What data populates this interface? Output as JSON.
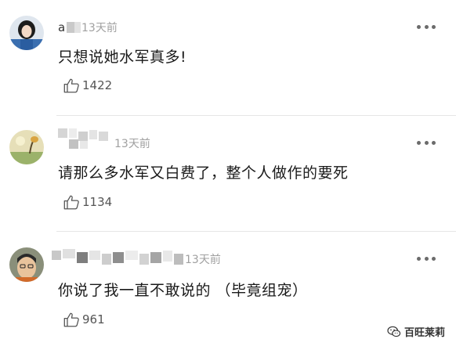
{
  "comments": [
    {
      "time": "13天前",
      "text": "只想说她水军真多!",
      "likes": "1422",
      "avatar_icon": "avatar-girl-photo",
      "name_visible_char": "a"
    },
    {
      "time": "13天前",
      "text": "请那么多水军又白费了，整个人做作的要死",
      "likes": "1134",
      "avatar_icon": "avatar-landscape-photo"
    },
    {
      "time": "13天前",
      "text": "你说了我一直不敢说的 （毕竟组宠）",
      "likes": "961",
      "avatar_icon": "avatar-man-photo"
    }
  ],
  "icons": {
    "more": "more-dots-icon",
    "like": "thumbs-up-icon",
    "watermark": "wechat-icon"
  },
  "watermark": {
    "label": "百旺莱莉"
  },
  "colors": {
    "text": "#1a1a1a",
    "meta": "#a0a0a0",
    "divider": "#e6e6e6"
  }
}
